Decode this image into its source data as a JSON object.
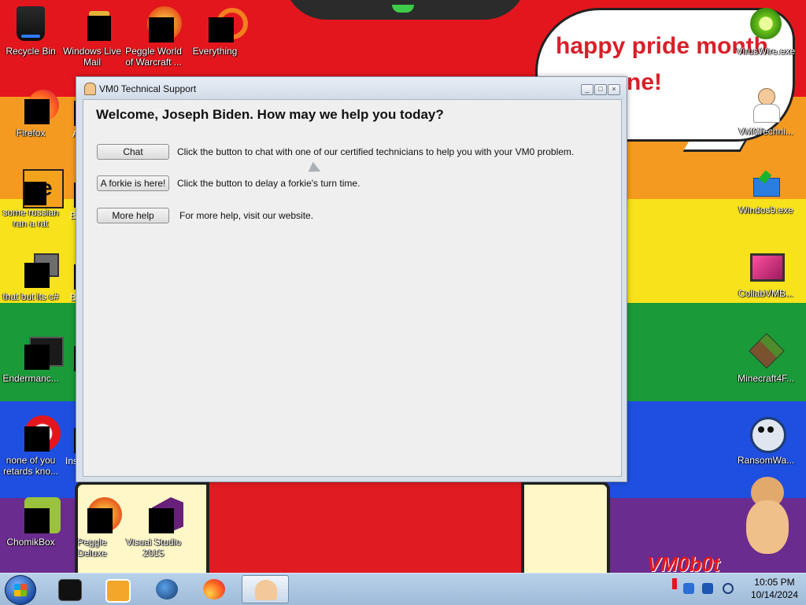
{
  "colors": {
    "rainbow": [
      "#e4161d",
      "#f59a20",
      "#f7e21b",
      "#1a9a38",
      "#1f4fe0",
      "#6a2c8e"
    ],
    "bubble_text": "#d8202a"
  },
  "bubble": {
    "line1": "happy pride month",
    "line2": "ne!"
  },
  "wallpaper_logo": "VM0b0t",
  "desktop_icons_left": [
    {
      "label": "Recycle Bin",
      "icon": "recycle-bin-icon"
    },
    {
      "label": "Windows Live Mail",
      "icon": "mail-icon"
    },
    {
      "label": "Peggle World of Warcraft ...",
      "icon": "peggle-icon"
    },
    {
      "label": "Everything",
      "icon": "everything-icon"
    },
    {
      "label": "Firefox",
      "icon": "firefox-icon"
    },
    {
      "label": "some russian ran a rat",
      "icon": "app-icon"
    },
    {
      "label": "that but its c#",
      "icon": "app-icon"
    },
    {
      "label": "Endermanc...",
      "icon": "app-icon"
    },
    {
      "label": "none of you retards kno...",
      "icon": "app-icon"
    },
    {
      "label": "ChomikBox",
      "icon": "chomikbox-icon"
    },
    {
      "label": "Peggle Deluxe",
      "icon": "peggle-icon"
    },
    {
      "label": "Visual Studio 2015",
      "icon": "visual-studio-icon"
    }
  ],
  "desktop_icons_partial": {
    "a": "A",
    "b1": "B",
    "b2": "B",
    "ins": "Ins"
  },
  "desktop_icons_right": [
    {
      "label": "VirusWire.exe",
      "icon": "lime-icon"
    },
    {
      "label": "VM0Techni...",
      "icon": "support-icon"
    },
    {
      "label": "Windos9.exe",
      "icon": "installer-icon"
    },
    {
      "label": "CollabVMB...",
      "icon": "monitor-icon"
    },
    {
      "label": "Minecraft4F...",
      "icon": "minecraft-icon"
    },
    {
      "label": "RansomWa...",
      "icon": "skull-icon"
    }
  ],
  "window": {
    "title": "VM0 Technical Support",
    "headline": "Welcome, Joseph Biden. How may we help you today?",
    "buttons": [
      {
        "label": "Chat",
        "desc": "Click the button to chat with one of our certified technicians to help you with your VM0 problem."
      },
      {
        "label": "A forkie is here!",
        "desc": "Click the button to delay a forkie's turn time."
      },
      {
        "label": "More help",
        "desc": "For more help, visit our website."
      }
    ],
    "controls": {
      "minimize": "_",
      "maximize": "□",
      "close": "×"
    }
  },
  "taskbar": {
    "items": [
      "terminal-icon",
      "media-player-icon",
      "globe-icon",
      "firefox-icon",
      "support-icon"
    ],
    "clock": {
      "time": "10:05 PM",
      "date": "10/14/2024"
    }
  }
}
